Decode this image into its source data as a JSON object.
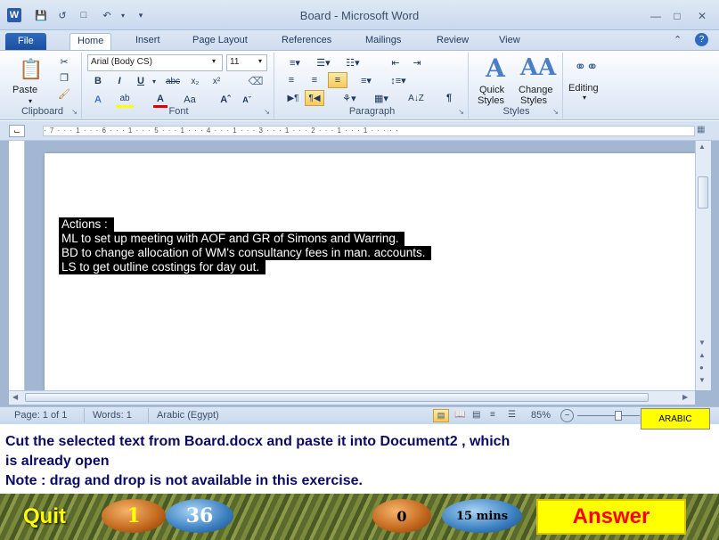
{
  "window": {
    "title": "Board  -  Microsoft Word"
  },
  "tabs": [
    "File",
    "Home",
    "Insert",
    "Page Layout",
    "References",
    "Mailings",
    "Review",
    "View"
  ],
  "ribbon": {
    "clipboard": {
      "label": "Clipboard",
      "paste": "Paste"
    },
    "font": {
      "label": "Font",
      "font_name": "Arial (Body CS)",
      "font_size": "11"
    },
    "paragraph": {
      "label": "Paragraph"
    },
    "styles": {
      "label": "Styles",
      "quick": "Quick",
      "quick2": "Styles",
      "change": "Change",
      "change2": "Styles"
    },
    "editing": {
      "label": "Editing"
    }
  },
  "ruler": {
    "marks": "· 7 · · · 1 · · · 6 · · · 1 · · · 5 · · · 1 · · · 4 · · · 1 · · · 3 · · · 1 · · · 2 · · · 1 · · · 1 · · · · ·"
  },
  "document": {
    "lines": [
      "Actions : ",
      "ML to set up meeting with AOF and GR of Simons and Warring. ",
      "BD to change allocation of WM's consultancy fees in man. accounts. ",
      "LS to get outline costings for day out. "
    ]
  },
  "status": {
    "page": "Page: 1 of 1",
    "words": "Words: 1",
    "language": "Arabic (Egypt)",
    "zoom": "85%",
    "keyboard": "ARABIC"
  },
  "instructions": {
    "line1": "Cut the selected text from Board.docx and paste it into Document2 , which",
    "line2": "is already open",
    "line3": "Note : drag and drop is not available in this exercise."
  },
  "bottom": {
    "quit": "Quit",
    "egg1": "1",
    "egg2": "36",
    "egg3": "0",
    "egg4": "15 mins",
    "answer": "Answer"
  }
}
